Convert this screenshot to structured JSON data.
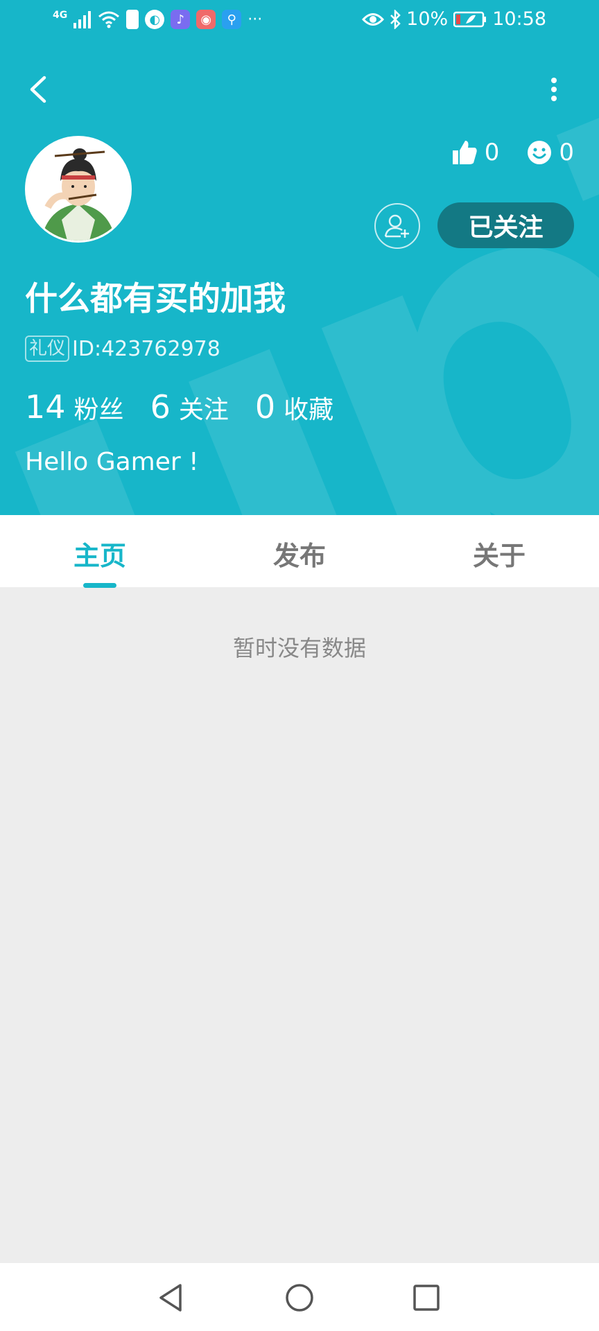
{
  "status_bar": {
    "network": "4G",
    "more": "···",
    "battery": "10%",
    "time": "10:58"
  },
  "header": {
    "watermark_text": "upTa",
    "likes": "0",
    "smiles": "0",
    "follow_label": "已关注",
    "username": "什么都有买的加我",
    "tag": "礼仪",
    "id_text": "ID:423762978",
    "counts": [
      {
        "value": "14",
        "label": "粉丝"
      },
      {
        "value": "6",
        "label": "关注"
      },
      {
        "value": "0",
        "label": "收藏"
      }
    ],
    "bio": "Hello Gamer !"
  },
  "tabs": [
    {
      "label": "主页",
      "active": true
    },
    {
      "label": "发布",
      "active": false
    },
    {
      "label": "关于",
      "active": false
    }
  ],
  "content": {
    "empty_text": "暂时没有数据"
  },
  "colors": {
    "accent": "#17b6c9",
    "follow_button": "#137984",
    "background": "#ededed"
  }
}
